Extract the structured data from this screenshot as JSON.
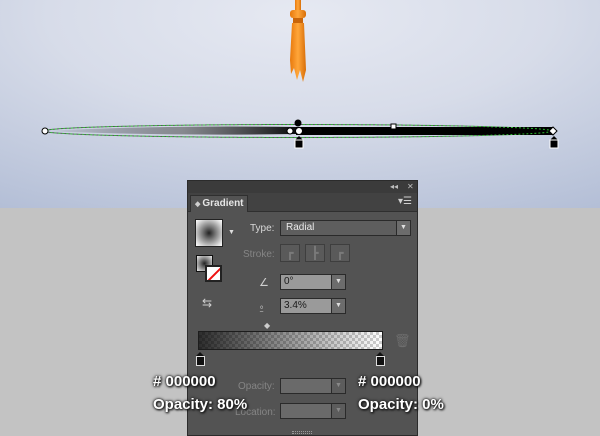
{
  "panel": {
    "tab_title": "Gradient",
    "type_label": "Type:",
    "type_value": "Radial",
    "stroke_label": "Stroke:",
    "angle_value": "0°",
    "aspect_value": "3.4%",
    "opacity_label": "Opacity:",
    "location_label": "Location:"
  },
  "stops": [
    {
      "color": "#000000",
      "opacity_percent": 80
    },
    {
      "color": "#000000",
      "opacity_percent": 0
    }
  ],
  "annotations": {
    "left_color": "# 000000",
    "left_opacity": "Opacity: 80%",
    "right_color": "# 000000",
    "right_opacity": "Opacity: 0%"
  },
  "colors": {
    "tassel": "#f39019",
    "background_top": "#e6e9f2",
    "background_bottom": "#b3bed6",
    "floor": "#c3c3c3",
    "panel": "#535353"
  },
  "icons": [
    "panel-collapse-icon",
    "panel-close-icon",
    "panel-menu-icon",
    "gradient-swatch-icon",
    "fill-stroke-icon",
    "aspect-toggle-icon",
    "angle-icon",
    "aspect-ratio-icon",
    "midpoint-diamond-icon",
    "trash-icon",
    "gradient-stop-icon"
  ]
}
